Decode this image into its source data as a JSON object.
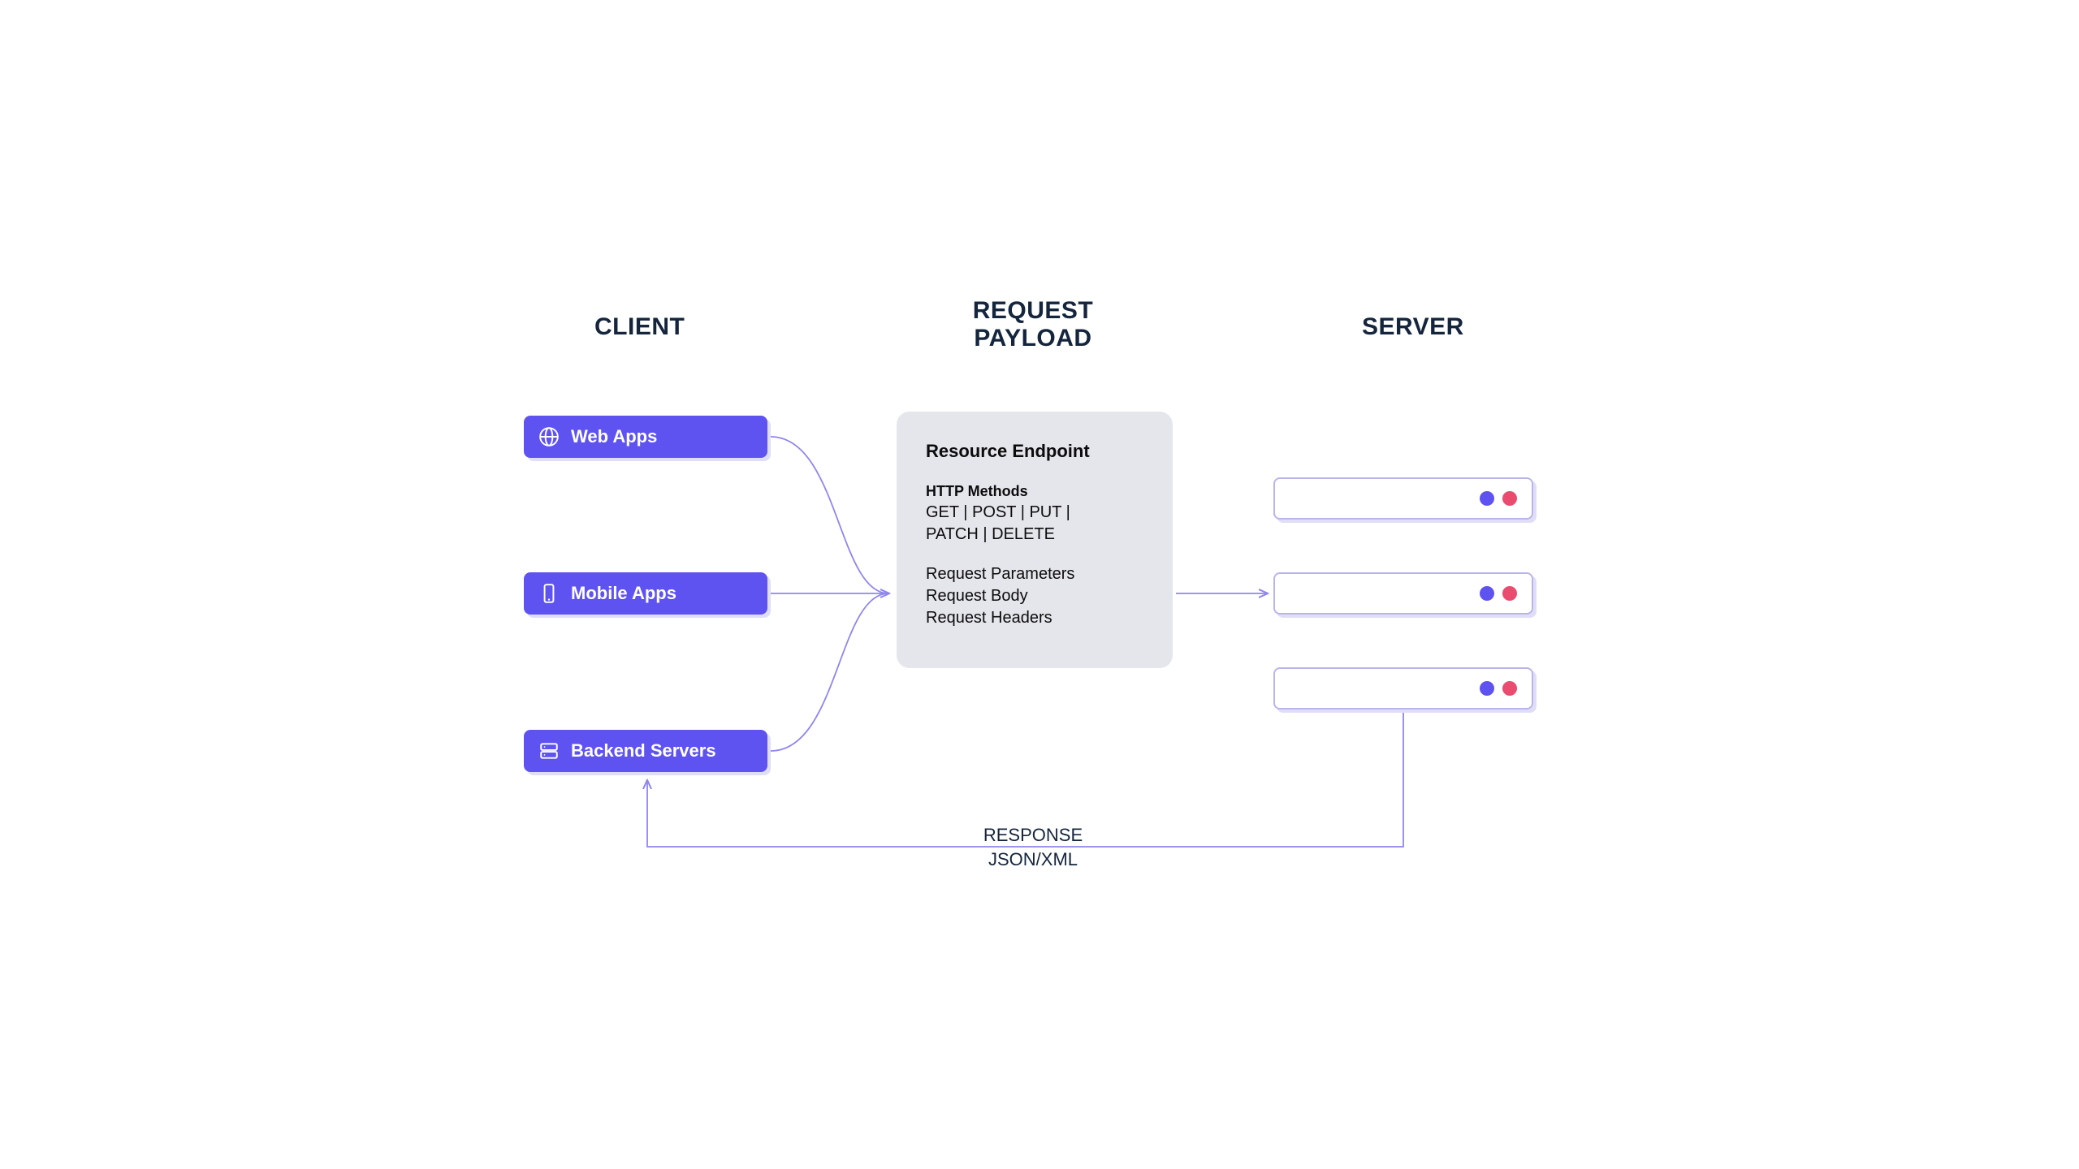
{
  "headings": {
    "client": "CLIENT",
    "payload_line1": "REQUEST",
    "payload_line2": "PAYLOAD",
    "server": "SERVER"
  },
  "clients": {
    "web": {
      "label": "Web Apps"
    },
    "mobile": {
      "label": "Mobile Apps"
    },
    "backend": {
      "label": "Backend Servers"
    }
  },
  "payload": {
    "title": "Resource Endpoint",
    "methods_label": "HTTP Methods",
    "methods_line1": "GET | POST | PUT |",
    "methods_line2": "PATCH | DELETE",
    "params": "Request Parameters",
    "body": "Request Body",
    "headers": "Request Headers"
  },
  "response": {
    "line1": "RESPONSE",
    "line2": "JSON/XML"
  },
  "colors": {
    "accent": "#5e53f1",
    "heading": "#14253d",
    "payload_bg": "#e5e6ec",
    "stroke": "#b9b5ec",
    "dot_blue": "#5e53f1",
    "dot_red": "#ea4c6f"
  }
}
